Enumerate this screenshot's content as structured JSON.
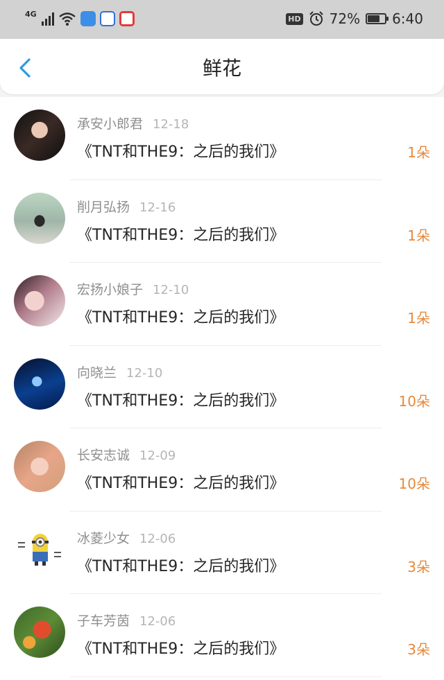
{
  "status_bar": {
    "network": "4G",
    "battery_percent": "72%",
    "battery_level": 0.72,
    "time": "6:40",
    "hd_label": "HD",
    "icons": [
      "signal-icon",
      "wifi-icon",
      "app-icon-blue",
      "baidu-icon",
      "app-icon-red",
      "hd-icon",
      "alarm-icon",
      "battery-icon"
    ]
  },
  "header": {
    "title": "鲜花",
    "back_icon": "chevron-left-icon",
    "accent_color": "#2b9be0"
  },
  "colors": {
    "count": "#e8883a",
    "meta": "#8f8f8f",
    "date": "#b5b5b5"
  },
  "gifts": [
    {
      "user": "承安小郎君",
      "date": "12-18",
      "book": "《TNT和THE9：之后的我们》",
      "count": "1朵"
    },
    {
      "user": "削月弘扬",
      "date": "12-16",
      "book": "《TNT和THE9：之后的我们》",
      "count": "1朵"
    },
    {
      "user": "宏扬小娘子",
      "date": "12-10",
      "book": "《TNT和THE9：之后的我们》",
      "count": "1朵"
    },
    {
      "user": "向晓兰",
      "date": "12-10",
      "book": "《TNT和THE9：之后的我们》",
      "count": "10朵"
    },
    {
      "user": "长安志诚",
      "date": "12-09",
      "book": "《TNT和THE9：之后的我们》",
      "count": "10朵"
    },
    {
      "user": "冰菱少女",
      "date": "12-06",
      "book": "《TNT和THE9：之后的我们》",
      "count": "3朵"
    },
    {
      "user": "子车芳茵",
      "date": "12-06",
      "book": "《TNT和THE9：之后的我们》",
      "count": "3朵"
    }
  ]
}
